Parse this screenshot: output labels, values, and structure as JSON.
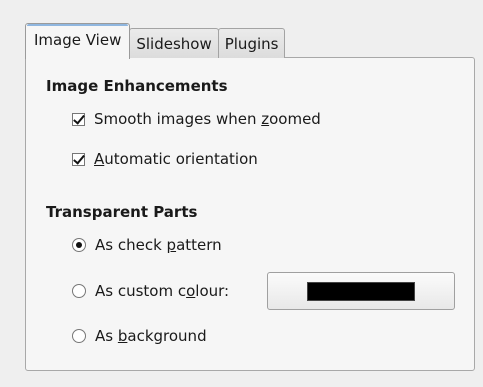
{
  "tabs": [
    {
      "label": "Image View",
      "active": true
    },
    {
      "label": "Slideshow",
      "active": false
    },
    {
      "label": "Plugins",
      "active": false
    }
  ],
  "enhancements": {
    "heading": "Image Enhancements",
    "smooth": {
      "pre": "Smooth images when ",
      "mnemonic": "z",
      "post": "oomed",
      "checked": true
    },
    "orientation": {
      "pre": "",
      "mnemonic": "A",
      "post": "utomatic orientation",
      "checked": true
    }
  },
  "transparent": {
    "heading": "Transparent Parts",
    "check_pattern": {
      "pre": "As check ",
      "mnemonic": "p",
      "post": "attern",
      "selected": true
    },
    "custom_colour": {
      "pre": "As custom c",
      "mnemonic": "o",
      "post": "lour:",
      "selected": false
    },
    "background": {
      "pre": "As ",
      "mnemonic": "b",
      "post": "ackground",
      "selected": false
    },
    "colour_value": "#000000"
  }
}
